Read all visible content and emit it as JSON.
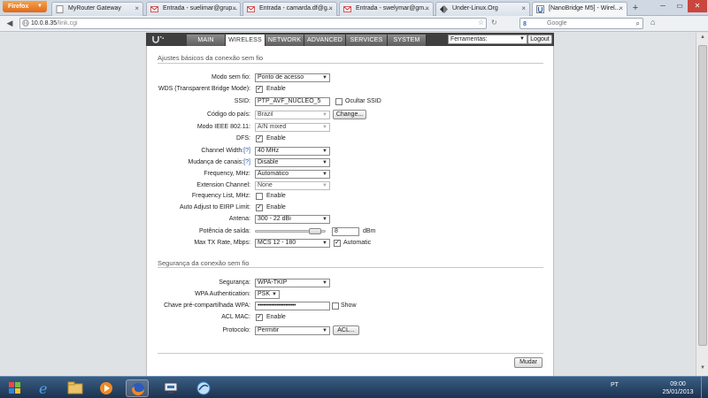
{
  "browser": {
    "app_button": "Firefox",
    "tabs": [
      {
        "label": "MyRouter Gateway",
        "fav": "page-icon"
      },
      {
        "label": "Entrada - suelimar@grup...",
        "fav": "gmail-icon"
      },
      {
        "label": "Entrada - camarda.df@g...",
        "fav": "gmail-icon"
      },
      {
        "label": "Entrada - swelymar@gm...",
        "fav": "gmail-icon"
      },
      {
        "label": "Under-Linux.Org",
        "fav": "ul-icon"
      },
      {
        "label": "[NanoBridge M5] - Wirel...",
        "fav": "ubnt-icon"
      }
    ],
    "url_host": "10.0.8.35",
    "url_path": "/link.cgi",
    "search_placeholder": "Google",
    "search_engine_label": "8"
  },
  "router": {
    "nav_tabs": [
      "MAIN",
      "WIRELESS",
      "NETWORK",
      "ADVANCED",
      "SERVICES",
      "SYSTEM"
    ],
    "active_tab": "WIRELESS",
    "tools_select": "Ferramentas:",
    "logout_label": "Logout"
  },
  "basic": {
    "section_title": "Ajustes básicos da conexão sem fio",
    "wireless_mode_label": "Modo sem fio:",
    "wireless_mode_value": "Ponto de acesso",
    "wds_label": "WDS (Transparent Bridge Mode):",
    "wds_check_label": "Enable",
    "ssid_label": "SSID:",
    "ssid_value": "PTP_AVF_NUCLEO_5",
    "hide_ssid_label": "Ocultar SSID",
    "country_label": "Código do país:",
    "country_value": "Brazil",
    "change_button": "Change...",
    "ieee_label": "Modo IEEE 802.11:",
    "ieee_value": "A/N mixed",
    "dfs_label": "DFS:",
    "dfs_check_label": "Enable",
    "channel_width_label": "Channel Width:",
    "channel_width_help": "[?]",
    "channel_width_value": "40 MHz",
    "channel_shift_label": "Mudança de canais:",
    "channel_shift_help": "[?]",
    "channel_shift_value": "Disable",
    "frequency_label": "Frequency, MHz:",
    "frequency_value": "Automático",
    "ext_channel_label": "Extension Channel:",
    "ext_channel_value": "None",
    "freq_list_label": "Frequency List, MHz:",
    "freq_list_check_label": "Enable",
    "auto_adjust_label": "Auto Adjust to EIRP Limit:",
    "auto_adjust_check_label": "Enable",
    "antenna_label": "Antena:",
    "antenna_value": "300 - 22 dBi",
    "power_label": "Potência de saída:",
    "power_value": "8",
    "power_unit": "dBm",
    "power_slider_fraction": 0.92,
    "tx_rate_label": "Max TX Rate, Mbps:",
    "tx_rate_value": "MCS 12 - 180",
    "automatic_label": "Automatic"
  },
  "security": {
    "section_title": "Segurança da conexão sem fio",
    "security_label": "Segurança:",
    "security_value": "WPA-TKIP",
    "wpa_auth_label": "WPA Authentication:",
    "wpa_auth_value": "PSK",
    "psk_label": "Chave pré-compartilhada WPA:",
    "psk_value": "••••••••••••••••••••••",
    "show_label": "Show",
    "acl_label": "ACL MAC:",
    "acl_check_label": "Enable",
    "protocol_label": "Protocolo:",
    "protocol_value": "Permitir",
    "acl_button": "ACL..."
  },
  "footer": {
    "change_button": "Mudar"
  },
  "taskbar": {
    "time": "09:00",
    "date": "25/01/2013",
    "tray_lang": "PT"
  }
}
